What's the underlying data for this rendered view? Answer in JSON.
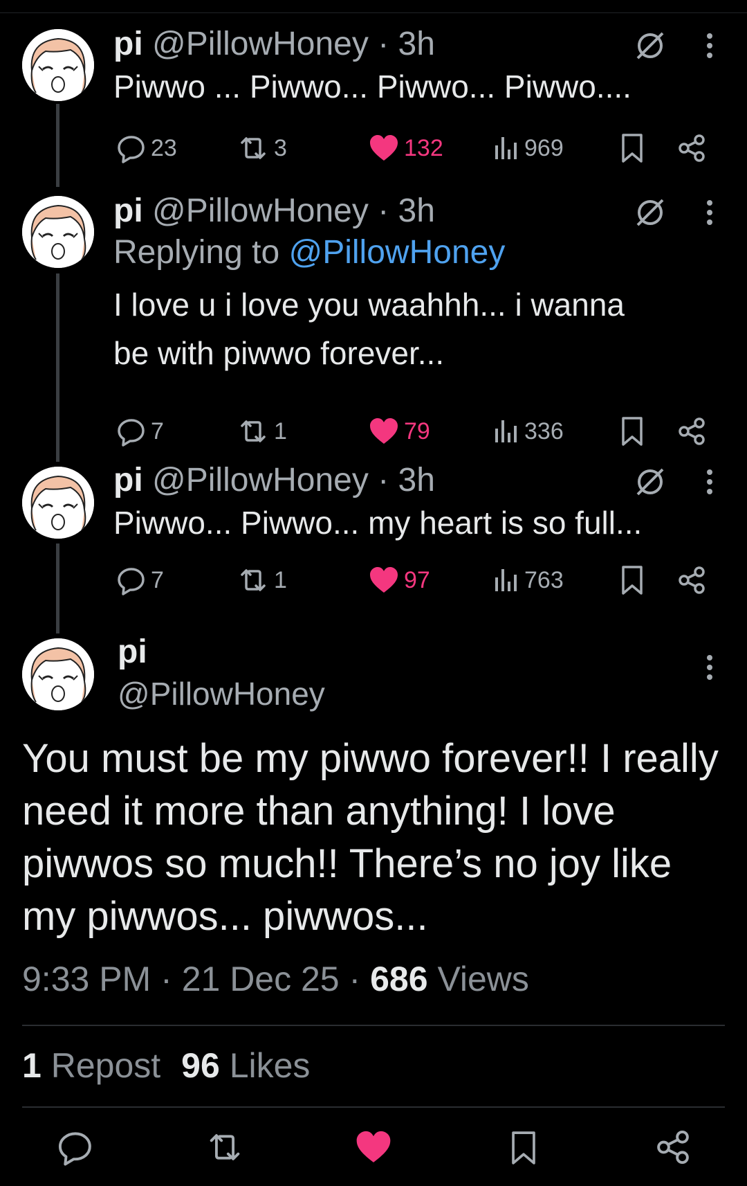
{
  "colors": {
    "background": "#000000",
    "text": "#e7e9ea",
    "muted": "#a6acb2",
    "accent_link": "#4fa2ef",
    "like": "#f4377f"
  },
  "thread": [
    {
      "name": "pi",
      "handle": "@PillowHoney",
      "dot": "·",
      "time": "3h",
      "replying_to_label": "",
      "replying_to_handle": "",
      "text_lines": [
        "Piwwo ... Piwwo... Piwwo... Piwwo...."
      ],
      "replies": "23",
      "reposts": "3",
      "likes": "132",
      "views": "969"
    },
    {
      "name": "pi",
      "handle": "@PillowHoney",
      "dot": "·",
      "time": "3h",
      "replying_to_label": "Replying to",
      "replying_to_handle": "@PillowHoney",
      "text_lines": [
        "I love u i love you waahhh... i wanna",
        "be with piwwo forever..."
      ],
      "replies": "7",
      "reposts": "1",
      "likes": "79",
      "views": "336"
    },
    {
      "name": "pi",
      "handle": "@PillowHoney",
      "dot": "·",
      "time": "3h",
      "replying_to_label": "",
      "replying_to_handle": "",
      "text_lines": [
        "Piwwo... Piwwo... my heart is so full..."
      ],
      "replies": "7",
      "reposts": "1",
      "likes": "97",
      "views": "763"
    }
  ],
  "main_tweet": {
    "name": "pi",
    "handle": "@PillowHoney",
    "text": "You must be my piwwo forever!! I really need it more than anything! I love piwwos so much!! There’s no joy like my piwwos... piwwos...",
    "time": "9:33 PM",
    "date": "21 Dec 25",
    "views_count": "686",
    "views_label": "Views",
    "sep": "·",
    "reposts_count": "1",
    "reposts_label": "Repost",
    "likes_count": "96",
    "likes_label": "Likes"
  },
  "icons": [
    "reply-icon",
    "repost-icon",
    "heart-icon",
    "views-icon",
    "bookmark-icon",
    "share-icon",
    "hide-reply-icon",
    "more-icon"
  ]
}
